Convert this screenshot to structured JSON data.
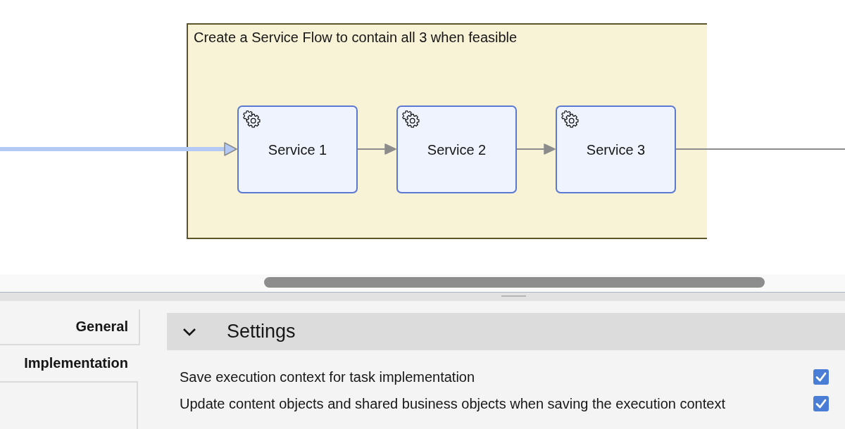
{
  "canvas": {
    "annotation": {
      "text": "Create a Service Flow to contain all 3 when feasible"
    },
    "tasks": [
      {
        "label": "Service 1"
      },
      {
        "label": "Service 2"
      },
      {
        "label": "Service 3"
      }
    ],
    "flows": [
      {
        "kind": "incoming",
        "selected": true
      },
      {
        "kind": "sequence",
        "selected": false
      },
      {
        "kind": "sequence",
        "selected": false
      },
      {
        "kind": "outgoing",
        "selected": false
      }
    ]
  },
  "properties": {
    "tabs": [
      {
        "label": "General",
        "selected": false
      },
      {
        "label": "Implementation",
        "selected": true
      }
    ],
    "section": {
      "title": "Settings",
      "expanded": true,
      "options": [
        {
          "label": "Save execution context for task implementation",
          "checked": true
        },
        {
          "label": "Update content objects and shared business objects when saving the execution context",
          "checked": true
        }
      ]
    }
  }
}
